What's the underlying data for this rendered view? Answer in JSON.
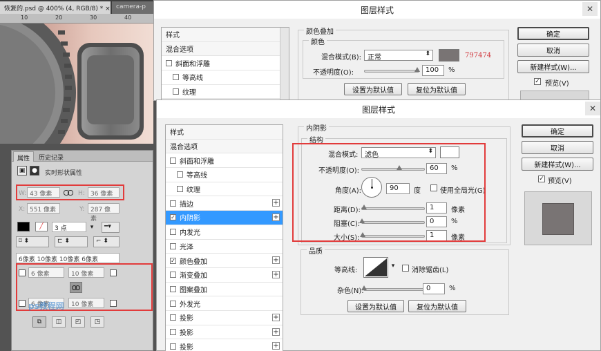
{
  "photoshop": {
    "tab_active": "恢复的.psd @ 400% (4, RGB/8) * ×",
    "tab_inactive": "camera-p",
    "ruler_marks": [
      "10",
      "20",
      "30",
      "40"
    ],
    "properties": {
      "tab_properties": "属性",
      "tab_history": "历史记录",
      "shape_title": "实时形状属性",
      "w_label": "W:",
      "w_value": "43 像素",
      "h_label": "H:",
      "h_value": "36 像素",
      "x_label": "X:",
      "x_value": "551 像素",
      "y_label": "Y:",
      "y_value": "287 像素",
      "stroke_width": "3 点",
      "radius_summary": "6像素 10像素 10像素 6像素",
      "radius_tl": "6 像素",
      "radius_tr": "10 像素",
      "radius_bl": "6 像素",
      "radius_br": "10 像素"
    },
    "watermark": "ps教程网"
  },
  "dialog_back": {
    "title": "图层样式",
    "styles": [
      {
        "label": "样式",
        "type": "header"
      },
      {
        "label": "混合选项",
        "type": "header"
      },
      {
        "label": "斜面和浮雕",
        "type": "check",
        "checked": false
      },
      {
        "label": "等高线",
        "type": "indent",
        "checked": false
      },
      {
        "label": "纹理",
        "type": "indent",
        "checked": false
      }
    ],
    "section_title": "颜色叠加",
    "group_title": "颜色",
    "blend_label": "混合模式(B):",
    "blend_value": "正常",
    "hex_value": "797474",
    "opacity_label": "不透明度(O):",
    "opacity_value": "100",
    "unit_percent": "%",
    "btn_set_default": "设置为默认值",
    "btn_reset_default": "复位为默认值",
    "btn_ok": "确定",
    "btn_cancel": "取消",
    "btn_new_style": "新建样式(W)...",
    "preview_label": "预览(V)",
    "swatch_color": "#797474"
  },
  "dialog_front": {
    "title": "图层样式",
    "styles": [
      {
        "label": "样式",
        "type": "header",
        "plus": false
      },
      {
        "label": "混合选项",
        "type": "header",
        "plus": false
      },
      {
        "label": "斜面和浮雕",
        "type": "check",
        "checked": false,
        "plus": false
      },
      {
        "label": "等高线",
        "type": "indent",
        "checked": false,
        "plus": false
      },
      {
        "label": "纹理",
        "type": "indent",
        "checked": false,
        "plus": false
      },
      {
        "label": "描边",
        "type": "check",
        "checked": false,
        "plus": true
      },
      {
        "label": "内阴影",
        "type": "check",
        "checked": true,
        "plus": true,
        "selected": true
      },
      {
        "label": "内发光",
        "type": "check",
        "checked": false,
        "plus": false
      },
      {
        "label": "光泽",
        "type": "check",
        "checked": false,
        "plus": false
      },
      {
        "label": "颜色叠加",
        "type": "check",
        "checked": true,
        "plus": true
      },
      {
        "label": "渐变叠加",
        "type": "check",
        "checked": false,
        "plus": true
      },
      {
        "label": "图案叠加",
        "type": "check",
        "checked": false,
        "plus": false
      },
      {
        "label": "外发光",
        "type": "check",
        "checked": false,
        "plus": false
      },
      {
        "label": "投影",
        "type": "check",
        "checked": false,
        "plus": true
      },
      {
        "label": "投影",
        "type": "check",
        "checked": false,
        "plus": true
      },
      {
        "label": "投影",
        "type": "check",
        "checked": false,
        "plus": true
      }
    ],
    "section_title": "内阴影",
    "structure_title": "结构",
    "blend_label": "混合模式:",
    "blend_value": "滤色",
    "shadow_color": "#ffffff",
    "opacity_label": "不透明度(O):",
    "opacity_value": "60",
    "angle_label": "角度(A):",
    "angle_value": "90",
    "angle_unit": "度",
    "global_light_label": "使用全局光(G)",
    "distance_label": "距离(D):",
    "distance_value": "1",
    "choke_label": "阻塞(C):",
    "choke_value": "0",
    "size_label": "大小(S):",
    "size_value": "1",
    "unit_px": "像素",
    "unit_percent": "%",
    "quality_title": "品质",
    "contour_label": "等高线:",
    "antialias_label": "消除锯齿(L)",
    "noise_label": "杂色(N):",
    "noise_value": "0",
    "btn_set_default": "设置为默认值",
    "btn_reset_default": "复位为默认值",
    "btn_ok": "确定",
    "btn_cancel": "取消",
    "btn_new_style": "新建样式(W)...",
    "preview_label": "预览(V)",
    "preview_color": "#797474"
  },
  "colors": {
    "selected_row": "#3399ff",
    "highlight_red": "#e23b3b",
    "hex_text": "#d0343a"
  }
}
